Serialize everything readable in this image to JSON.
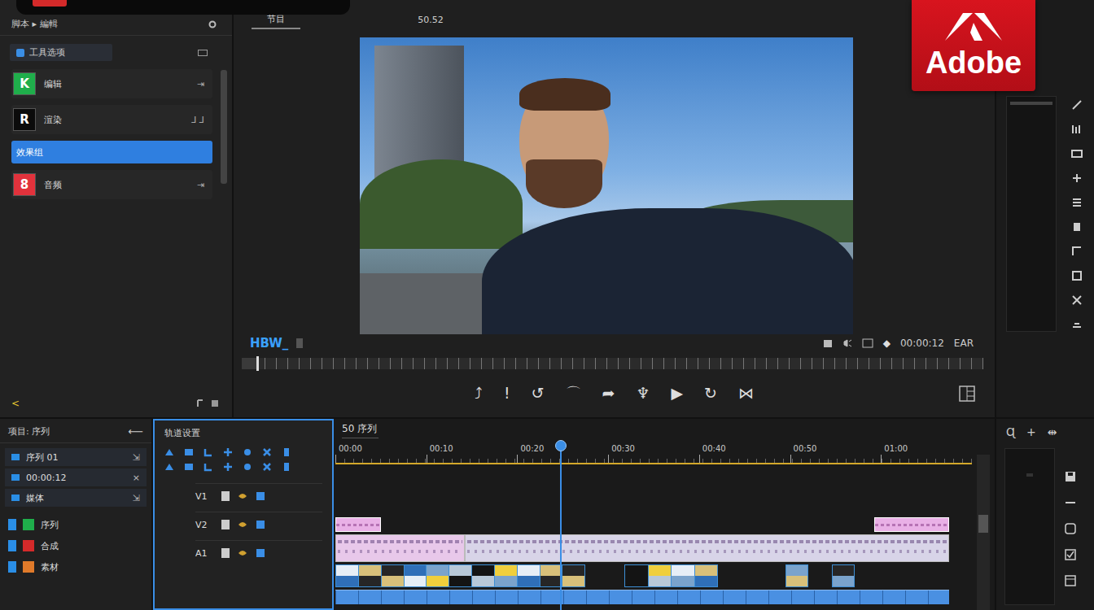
{
  "left_panel": {
    "title": "脚本 ▸ 編輯",
    "section": "工具选项",
    "items": [
      {
        "kind": "icon",
        "icon": "K",
        "label": "编辑",
        "trail": "⇥",
        "color": "#1fae4b",
        "selected": false
      },
      {
        "kind": "icon",
        "icon": "R",
        "label": "渲染",
        "trail": "⅃ ⅃",
        "color": "#0b0b0b",
        "selected": false
      },
      {
        "kind": "plain",
        "label": "效果组",
        "selected": true
      },
      {
        "kind": "icon",
        "icon": "8",
        "label": "音频",
        "trail": "⇥",
        "color": "#e2323c",
        "selected": false
      }
    ],
    "footer": "<"
  },
  "viewer": {
    "tabs": [
      {
        "label": "节目",
        "selected": true
      },
      {
        "label": "50.52",
        "selected": false
      }
    ],
    "source_label": "HBW_",
    "marker": "◆",
    "timecode": "00:00:12",
    "end_label": "EAR",
    "scrub_level": 0.02,
    "controls": [
      "⤴",
      "!",
      "↺",
      "⌒",
      "➦",
      "♆",
      "▶",
      "↻",
      "⋈"
    ]
  },
  "logo": {
    "text": "Adobe"
  },
  "project": {
    "title": "项目: 序列",
    "back": "⟵",
    "rows": [
      {
        "label": "序列 01",
        "trail": "⇲"
      },
      {
        "label": "00:00:12",
        "trail": "×"
      },
      {
        "label": "媒体",
        "trail": "⇲"
      }
    ],
    "bins": [
      {
        "label": "序列",
        "color": "#1fae4b"
      },
      {
        "label": "合成",
        "color": "#d42a2a"
      },
      {
        "label": "素材",
        "color": "#e07a2a"
      }
    ]
  },
  "tracks_panel": {
    "title": "轨道设置",
    "rows": [
      {
        "label": "V1"
      },
      {
        "label": "V2"
      },
      {
        "label": "A1"
      }
    ]
  },
  "timeline": {
    "title": "50 序列",
    "duration": 70,
    "playhead": 24.8,
    "ticks": [
      "00:00",
      "00:10",
      "00:20",
      "00:30",
      "00:40",
      "00:50",
      "01:00"
    ],
    "tracks": [
      {
        "kind": "title",
        "clips": [
          {
            "start": 0,
            "end": 5,
            "color": "#e9b0e6"
          },
          {
            "start": 59.3,
            "end": 67.5,
            "color": "#e9b0e6"
          }
        ]
      },
      {
        "kind": "waveform",
        "clips": [
          {
            "start": 0,
            "end": 14.2,
            "color": "#e8c8ea"
          },
          {
            "start": 14.2,
            "end": 67.5,
            "color": "#d8d4e8"
          }
        ]
      },
      {
        "kind": "video",
        "clips": [
          {
            "start": 0,
            "end": 27.5,
            "color": "#3d8fd6"
          },
          {
            "start": 31.8,
            "end": 42.1,
            "color": "#3d8fd6"
          },
          {
            "start": 49.5,
            "end": 52,
            "color": "#3d8fd6"
          },
          {
            "start": 54.6,
            "end": 57.1,
            "color": "#3d8fd6"
          }
        ]
      },
      {
        "kind": "audio",
        "clips": [
          {
            "start": 0,
            "end": 67.5,
            "color": "#4a90e2"
          }
        ]
      }
    ]
  },
  "side_tools": [
    "Ɋ",
    "+",
    "⇹"
  ]
}
